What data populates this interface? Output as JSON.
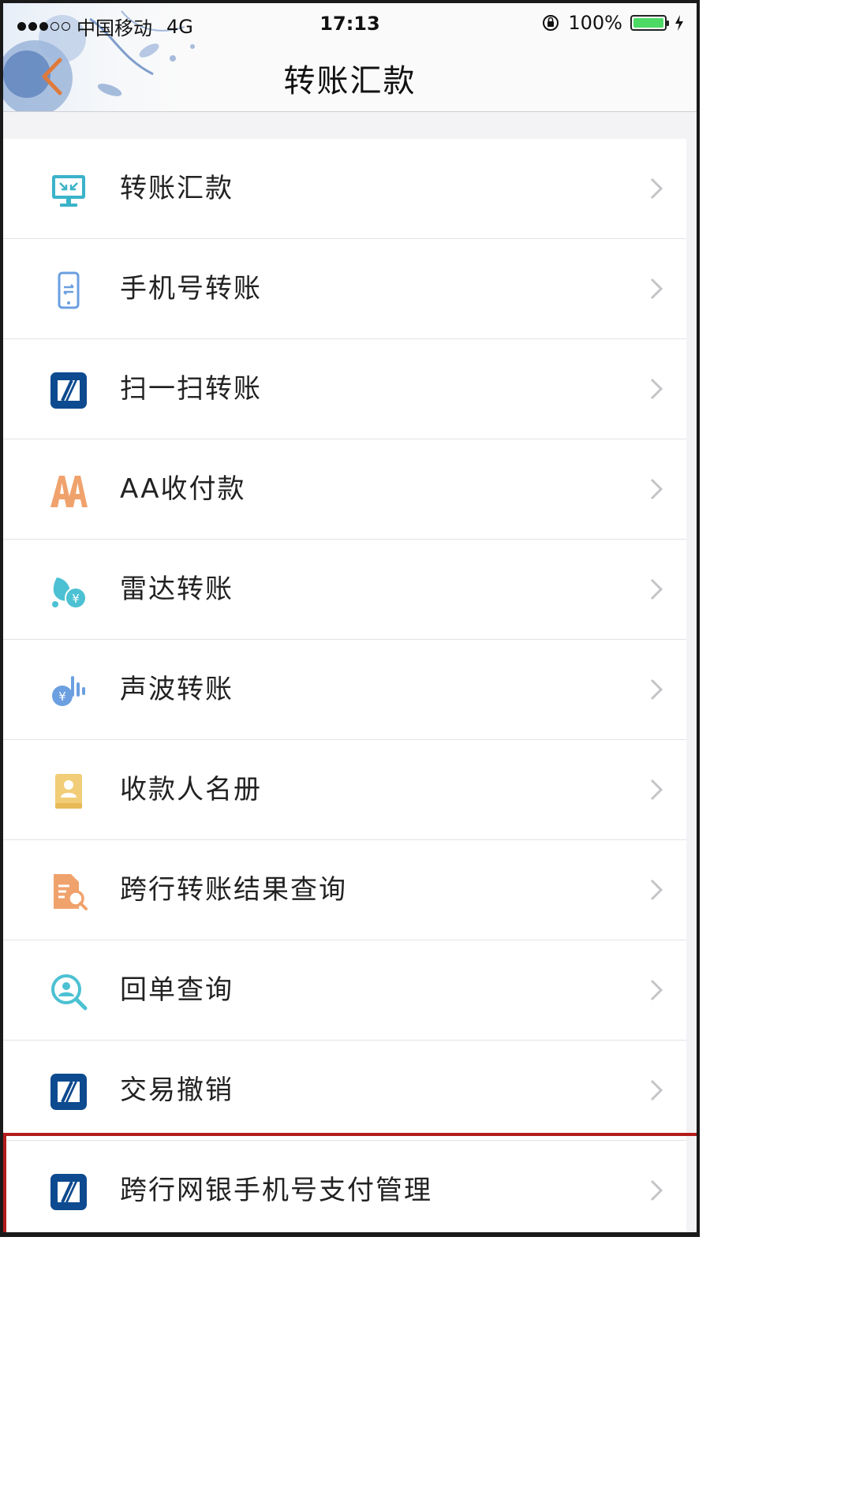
{
  "status_bar": {
    "carrier": "中国移动",
    "network": "4G",
    "time": "17:13",
    "battery": "100%"
  },
  "nav": {
    "title": "转账汇款"
  },
  "menu": {
    "items": [
      {
        "label": "转账汇款",
        "icon": "transfer-screen-icon"
      },
      {
        "label": "手机号转账",
        "icon": "mobile-phone-icon"
      },
      {
        "label": "扫一扫转账",
        "icon": "bank-logo-icon"
      },
      {
        "label": "AA收付款",
        "icon": "aa-icon"
      },
      {
        "label": "雷达转账",
        "icon": "radar-icon"
      },
      {
        "label": "声波转账",
        "icon": "soundwave-icon"
      },
      {
        "label": "收款人名册",
        "icon": "payee-book-icon"
      },
      {
        "label": "跨行转账结果查询",
        "icon": "document-search-icon"
      },
      {
        "label": "回单查询",
        "icon": "receipt-search-icon"
      },
      {
        "label": "交易撤销",
        "icon": "bank-logo-icon"
      },
      {
        "label": "跨行网银手机号支付管理",
        "icon": "bank-logo-icon"
      }
    ]
  },
  "colors": {
    "highlight_border": "#b31c1c",
    "bank_blue": "#0d4a8f",
    "teal": "#3ab3c9",
    "orange": "#f0a26c",
    "yellow": "#f2cd77"
  }
}
